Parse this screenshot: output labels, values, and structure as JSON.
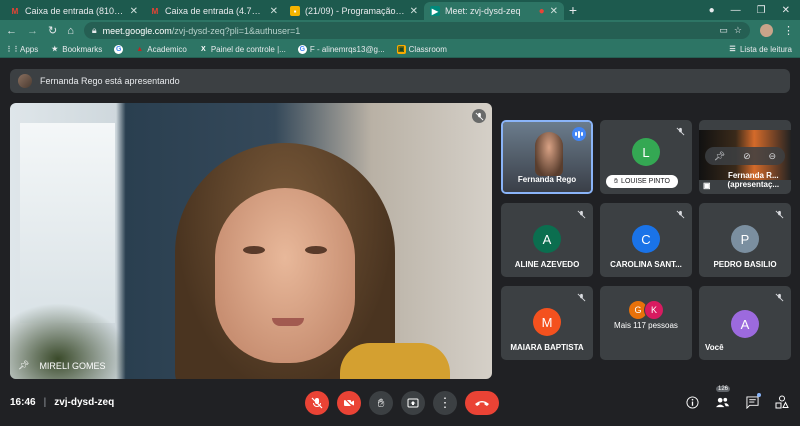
{
  "browser": {
    "tabs": [
      {
        "title": "Caixa de entrada (810) - alinemr",
        "icon": "gmail-icon",
        "active": false
      },
      {
        "title": "Caixa de entrada (4.712) - alinem",
        "icon": "gmail-icon",
        "active": false
      },
      {
        "title": "(21/09) - Programação Enfermag",
        "icon": "slides-icon",
        "active": false
      },
      {
        "title": "Meet: zvj-dysd-zeq",
        "icon": "meet-icon",
        "active": true
      }
    ],
    "url_host": "meet.google.com",
    "url_path": "/zvj-dysd-zeq?pli=1&authuser=1",
    "bookmarks": [
      {
        "label": "Apps",
        "icon": "apps-grid-icon"
      },
      {
        "label": "Bookmarks",
        "icon": "star-icon"
      },
      {
        "label": "",
        "icon": "google-icon"
      },
      {
        "label": "Academico",
        "icon": "academico-icon"
      },
      {
        "label": "Painel de controle |...",
        "icon": "x-icon"
      },
      {
        "label": "F - alinemrqs13@g...",
        "icon": "google-icon"
      },
      {
        "label": "Classroom",
        "icon": "classroom-icon"
      }
    ],
    "reading_list": "Lista de leitura"
  },
  "meet": {
    "presenting_text": "Fernanda Rego está apresentando",
    "main_speaker": "MIRELI GOMES",
    "tiles": [
      {
        "name": "Fernanda Rego",
        "type": "video",
        "speaking": true
      },
      {
        "name": "LOUISE PINTO",
        "initial": "L",
        "color": "#34a853",
        "hand_raised": true
      },
      {
        "name": "Fernanda R... (apresentaç...",
        "type": "presentation"
      },
      {
        "name": "ALINE AZEVEDO",
        "initial": "A",
        "color": "#0b6e4f"
      },
      {
        "name": "CAROLINA SANT...",
        "initial": "C",
        "color": "#1a73e8"
      },
      {
        "name": "PEDRO BASILIO",
        "initial": "P",
        "color": "#7b8fa0"
      },
      {
        "name": "MAIARA BAPTISTA",
        "initial": "M",
        "color": "#f4511e"
      },
      {
        "name": "Mais 117 pessoas",
        "initials": [
          "G",
          "K"
        ],
        "colors": [
          "#e8710a",
          "#d81b60"
        ]
      },
      {
        "name": "Você",
        "initial": "A",
        "color": "#9c6ade"
      }
    ],
    "time": "16:46",
    "meeting_code": "zvj-dysd-zeq",
    "participant_count": "126",
    "colors": {
      "danger": "#ea4335",
      "accent": "#8ab4f8",
      "surface": "#3c4043"
    }
  }
}
